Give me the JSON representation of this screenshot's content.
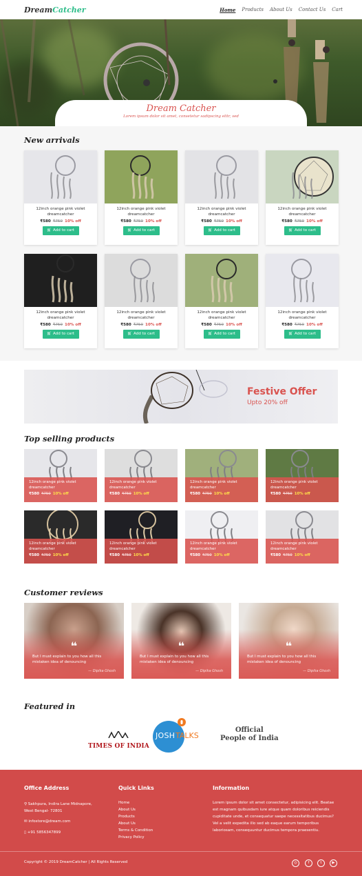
{
  "brand": {
    "part1": "Dream",
    "part2": "Catcher"
  },
  "nav": [
    "Home",
    "Products",
    "About Us",
    "Contact Us",
    "Cart"
  ],
  "hero": {
    "title": "Dream Catcher",
    "subtitle": "Lorem ipsum dolor sit amet, consetetur sadipscing elitr, sed"
  },
  "new_arrivals": {
    "title": "New arrivals",
    "products": [
      {
        "name": "12inch orange pink violet dreamcatcher",
        "price": "₹580",
        "old_price": "₹750",
        "discount": "10% off",
        "button": "Add to cart"
      },
      {
        "name": "12inch orange pink violet dreamcatcher",
        "price": "₹580",
        "old_price": "₹750",
        "discount": "10% off",
        "button": "Add to cart"
      },
      {
        "name": "12inch orange pink violet dreamcatcher",
        "price": "₹580",
        "old_price": "₹750",
        "discount": "10% off",
        "button": "Add to cart"
      },
      {
        "name": "12inch orange pink violet dreamcatcher",
        "price": "₹580",
        "old_price": "₹750",
        "discount": "10% off",
        "button": "Add to cart"
      },
      {
        "name": "12inch orange pink violet dreamcatcher",
        "price": "₹580",
        "old_price": "₹750",
        "discount": "10% off",
        "button": "Add to cart"
      },
      {
        "name": "12inch orange pink violet dreamcatcher",
        "price": "₹580",
        "old_price": "₹750",
        "discount": "10% off",
        "button": "Add to cart"
      },
      {
        "name": "12inch orange pink violet dreamcatcher",
        "price": "₹580",
        "old_price": "₹750",
        "discount": "10% off",
        "button": "Add to cart"
      },
      {
        "name": "12inch orange pink violet dreamcatcher",
        "price": "₹580",
        "old_price": "₹750",
        "discount": "10% off",
        "button": "Add to cart"
      }
    ]
  },
  "banner": {
    "title": "Festive Offer",
    "subtitle": "Upto 20% off"
  },
  "top_selling": {
    "title": "Top selling products",
    "products": [
      {
        "name": "12inch orange pink violet dreamcatcher",
        "price": "₹580",
        "old_price": "₹750",
        "discount": "10% off"
      },
      {
        "name": "12inch orange pink violet dreamcatcher",
        "price": "₹580",
        "old_price": "₹750",
        "discount": "10% off"
      },
      {
        "name": "12inch orange pink violet dreamcatcher",
        "price": "₹580",
        "old_price": "₹750",
        "discount": "10% off"
      },
      {
        "name": "12inch orange pink violet dreamcatcher",
        "price": "₹580",
        "old_price": "₹750",
        "discount": "10% off"
      },
      {
        "name": "12inch orange pink violet dreamcatcher",
        "price": "₹580",
        "old_price": "₹750",
        "discount": "10% off"
      },
      {
        "name": "12inch orange pink violet dreamcatcher",
        "price": "₹580",
        "old_price": "₹750",
        "discount": "10% off"
      },
      {
        "name": "12inch orange pink violet dreamcatcher",
        "price": "₹580",
        "old_price": "₹750",
        "discount": "10% off"
      },
      {
        "name": "12inch orange pink violet dreamcatcher",
        "price": "₹580",
        "old_price": "₹750",
        "discount": "10% off"
      }
    ]
  },
  "reviews": {
    "title": "Customer reviews",
    "items": [
      {
        "text": "But I must explain to you how all this mistaken idea of denouncing",
        "author": "— Dipika Ghosh"
      },
      {
        "text": "But I must explain to you how all this mistaken idea of denouncing",
        "author": "— Dipika Ghosh"
      },
      {
        "text": "But I must explain to you how all this mistaken idea of denouncing",
        "author": "— Dipika Ghosh"
      }
    ]
  },
  "featured": {
    "title": "Featured in",
    "logos": {
      "toi": "TIMES OF INDIA",
      "josh_a": "JOSH",
      "josh_b": "TALKS",
      "opi_line1": "Official",
      "opi_line2": "People of India"
    }
  },
  "footer": {
    "office": {
      "heading": "Office Address",
      "address": "Sakhpura, Indira Lane Midnapore, West Bengal- 72801",
      "email": "infostore@dream.com",
      "phone": "+91 5856347899"
    },
    "links": {
      "heading": "Quick Links",
      "items": [
        "Home",
        "About Us",
        "Products",
        "About Us",
        "Terms & Condition",
        "Privacy Policy"
      ]
    },
    "info": {
      "heading": "Information",
      "text": "Lorem ipsum dolor sit amet consectetur, adipisicing elit. Beatae est magnam quibusdam iure atque quam doloribus reiciendis cupiditate unde, et consequatur saepe necessitatibus ducimus? Vel a velit expedita illo sed ab eaque earum temporibus laboriosam, consequuntur ducimus tempora praesentiu."
    },
    "copyright": "Copyright © 2019 DreamCatcher | All Rights Reserved",
    "social": [
      "instagram-icon",
      "facebook-icon",
      "twitter-icon",
      "youtube-icon"
    ]
  },
  "colors": {
    "accent": "#d9534f",
    "green": "#2dbd8a",
    "footer": "#d24b4a"
  }
}
